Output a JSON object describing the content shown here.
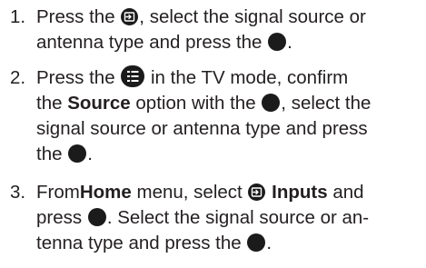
{
  "steps": [
    {
      "number": "1.",
      "lines": [
        {
          "a": "Press the ",
          "b": ", select the signal source or"
        },
        {
          "a": "antenna type and press the ",
          "b": "."
        }
      ]
    },
    {
      "number": "2.",
      "lines": [
        {
          "a": "Press the ",
          "b": " in the TV mode, confirm"
        },
        {
          "a": "the ",
          "bold": "Source",
          "b": " option with the ",
          "c": ", select the"
        },
        {
          "a": "signal source or antenna type and press"
        },
        {
          "a": "the ",
          "b": "."
        }
      ]
    },
    {
      "number": "3.",
      "lines": [
        {
          "a": "From",
          "bold": "Home",
          "b": " menu, select ",
          "bold2": "Inputs",
          "c": " and"
        },
        {
          "a": "press ",
          "b": ". Select the signal source or an-"
        },
        {
          "a": "tenna type and press the ",
          "b": "."
        }
      ]
    }
  ],
  "icons": {
    "input": "input-source-icon",
    "menu": "menu-list-icon",
    "ok": "ok-button-icon"
  }
}
